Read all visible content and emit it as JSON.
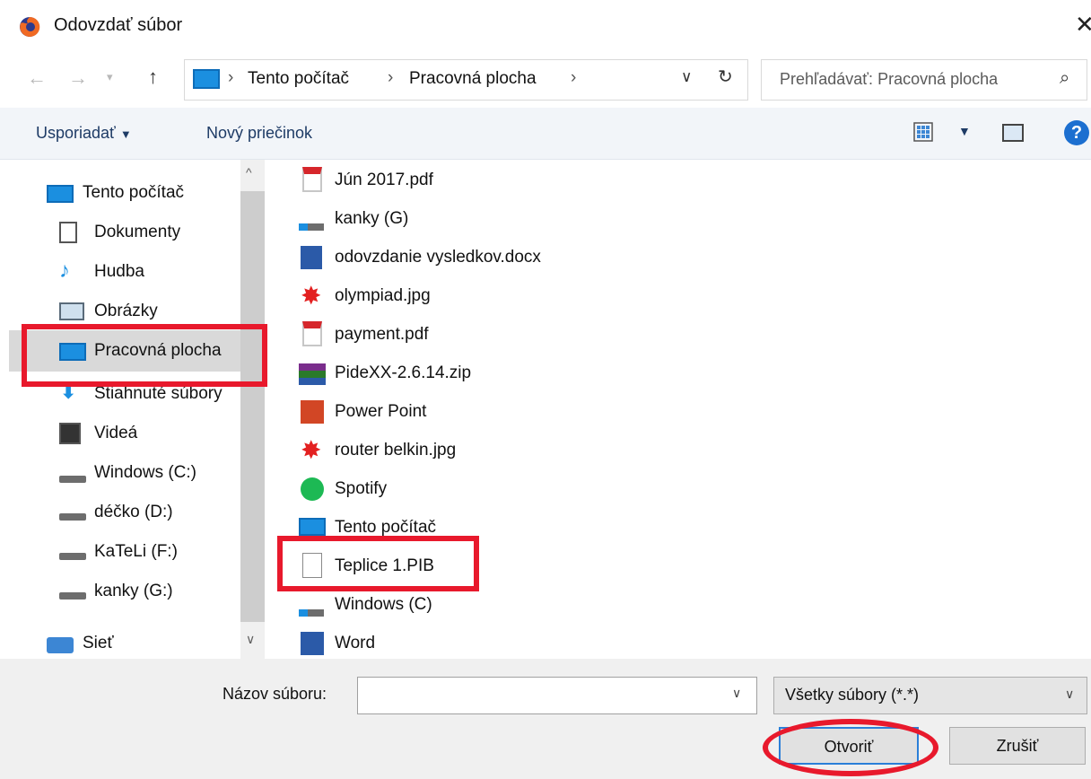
{
  "window": {
    "title": "Odovzdať súbor"
  },
  "address": {
    "crumbs": [
      "Tento počítač",
      "Pracovná plocha"
    ],
    "search_placeholder": "Prehľadávať: Pracovná plocha"
  },
  "toolbar": {
    "organize": "Usporiadať",
    "new_folder": "Nový priečinok",
    "help": "?"
  },
  "nav": {
    "items": [
      {
        "label": "Tento počítač",
        "icon": "computer-icon"
      },
      {
        "label": "Dokumenty",
        "icon": "documents-icon"
      },
      {
        "label": "Hudba",
        "icon": "music-icon"
      },
      {
        "label": "Obrázky",
        "icon": "pictures-icon"
      },
      {
        "label": "Pracovná plocha",
        "icon": "desktop-icon"
      },
      {
        "label": "Stiahnuté súbory",
        "icon": "downloads-icon"
      },
      {
        "label": "Videá",
        "icon": "videos-icon"
      },
      {
        "label": "Windows (C:)",
        "icon": "drive-windows-icon"
      },
      {
        "label": "déčko (D:)",
        "icon": "drive-icon"
      },
      {
        "label": "KaTeLi (F:)",
        "icon": "drive-icon"
      },
      {
        "label": "kanky (G:)",
        "icon": "drive-icon"
      },
      {
        "label": "Sieť",
        "icon": "network-icon"
      }
    ],
    "selected": "Pracovná plocha"
  },
  "files": [
    {
      "name": "Jún 2017.pdf",
      "icon": "pdf-icon"
    },
    {
      "name": "kanky (G)",
      "icon": "shortcut-drive-icon"
    },
    {
      "name": "odovzdanie vysledkov.docx",
      "icon": "word-doc-icon"
    },
    {
      "name": "olympiad.jpg",
      "icon": "image-file-icon"
    },
    {
      "name": "payment.pdf",
      "icon": "pdf-icon"
    },
    {
      "name": "PideXX-2.6.14.zip",
      "icon": "zip-archive-icon"
    },
    {
      "name": "Power Point",
      "icon": "powerpoint-shortcut-icon"
    },
    {
      "name": "router belkin.jpg",
      "icon": "image-file-icon"
    },
    {
      "name": "Spotify",
      "icon": "spotify-shortcut-icon"
    },
    {
      "name": "Tento počítač",
      "icon": "computer-shortcut-icon"
    },
    {
      "name": "Teplice 1.PIB",
      "icon": "blank-file-icon"
    },
    {
      "name": "Windows (C)",
      "icon": "drive-shortcut-icon"
    },
    {
      "name": "Word",
      "icon": "word-shortcut-icon"
    }
  ],
  "bottom": {
    "filename_label": "Názov súboru:",
    "filename_value": "",
    "filter_value": "Všetky súbory (*.*)",
    "open_label": "Otvoriť",
    "cancel_label": "Zrušiť"
  },
  "colors": {
    "annotation": "#e8192c",
    "accent": "#2b7fd8",
    "toolbar_bg": "#f2f5f9"
  }
}
